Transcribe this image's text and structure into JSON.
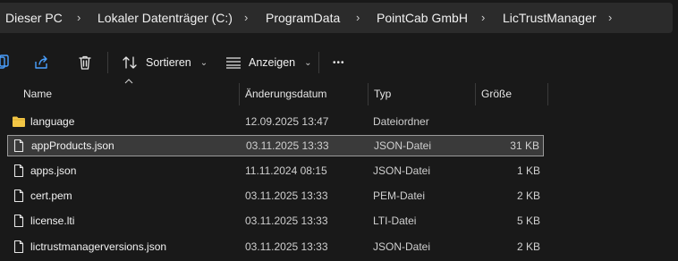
{
  "breadcrumb": {
    "items": [
      "Dieser PC",
      "Lokaler Datenträger (C:)",
      "ProgramData",
      "PointCab GmbH",
      "LicTrustManager"
    ],
    "separator": "›"
  },
  "toolbar": {
    "sort_label": "Sortieren",
    "view_label": "Anzeigen",
    "more_label": "•••"
  },
  "columns": {
    "name": "Name",
    "date": "Änderungsdatum",
    "type": "Typ",
    "size": "Größe"
  },
  "files": [
    {
      "name": "language",
      "date": "12.09.2025 13:47",
      "type": "Dateiordner",
      "size": "",
      "icon": "folder-icon"
    },
    {
      "name": "appProducts.json",
      "date": "03.11.2025 13:33",
      "type": "JSON-Datei",
      "size": "31 KB",
      "icon": "file-icon",
      "selected": true
    },
    {
      "name": "apps.json",
      "date": "11.11.2024 08:15",
      "type": "JSON-Datei",
      "size": "1 KB",
      "icon": "file-icon"
    },
    {
      "name": "cert.pem",
      "date": "03.11.2025 13:33",
      "type": "PEM-Datei",
      "size": "2 KB",
      "icon": "file-icon"
    },
    {
      "name": "license.lti",
      "date": "03.11.2025 13:33",
      "type": "LTI-Datei",
      "size": "5 KB",
      "icon": "file-icon"
    },
    {
      "name": "lictrustmanagerversions.json",
      "date": "03.11.2025 13:33",
      "type": "JSON-Datei",
      "size": "2 KB",
      "icon": "file-icon"
    }
  ],
  "colors": {
    "background": "#191919",
    "address_bar": "#2b2b2b",
    "selection": "#3a3a3a",
    "folder": "#f3c645"
  }
}
